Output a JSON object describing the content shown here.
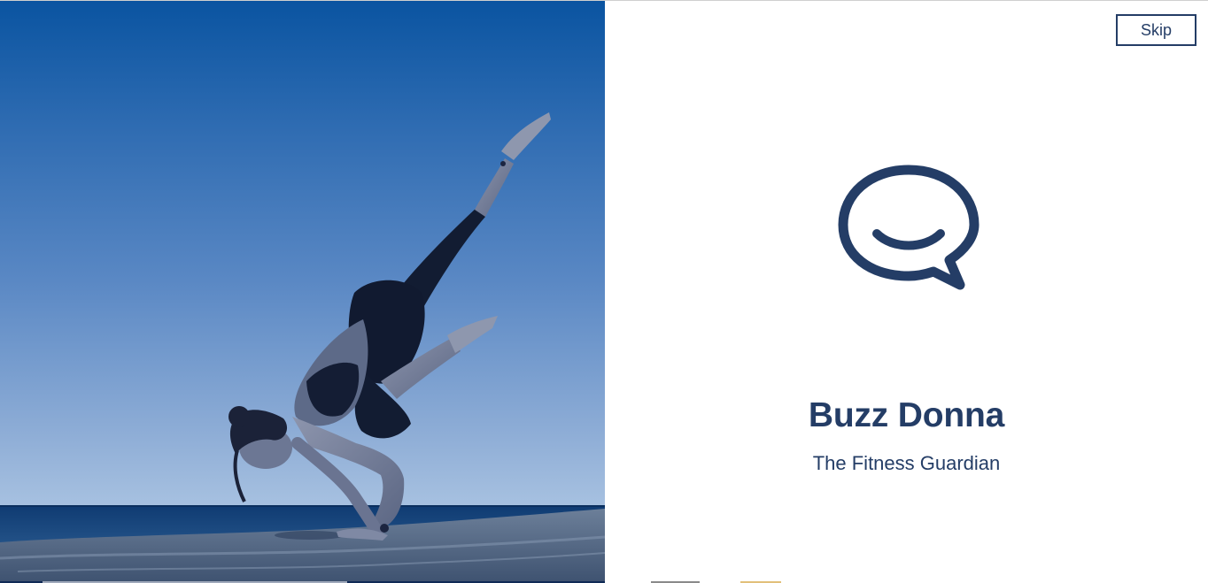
{
  "app": {
    "name": "Buzz Donna",
    "tagline": "The Fitness Guardian"
  },
  "actions": {
    "skip_label": "Skip"
  },
  "icons": {
    "logo": "chat-bubble-smile-icon"
  },
  "colors": {
    "brand": "#243d66",
    "hero_sky_top": "#0b57a3",
    "hero_sky_bottom": "#a9c3e2",
    "sea": "#123f74",
    "rock": "#4a5f7c",
    "background": "#ffffff"
  }
}
